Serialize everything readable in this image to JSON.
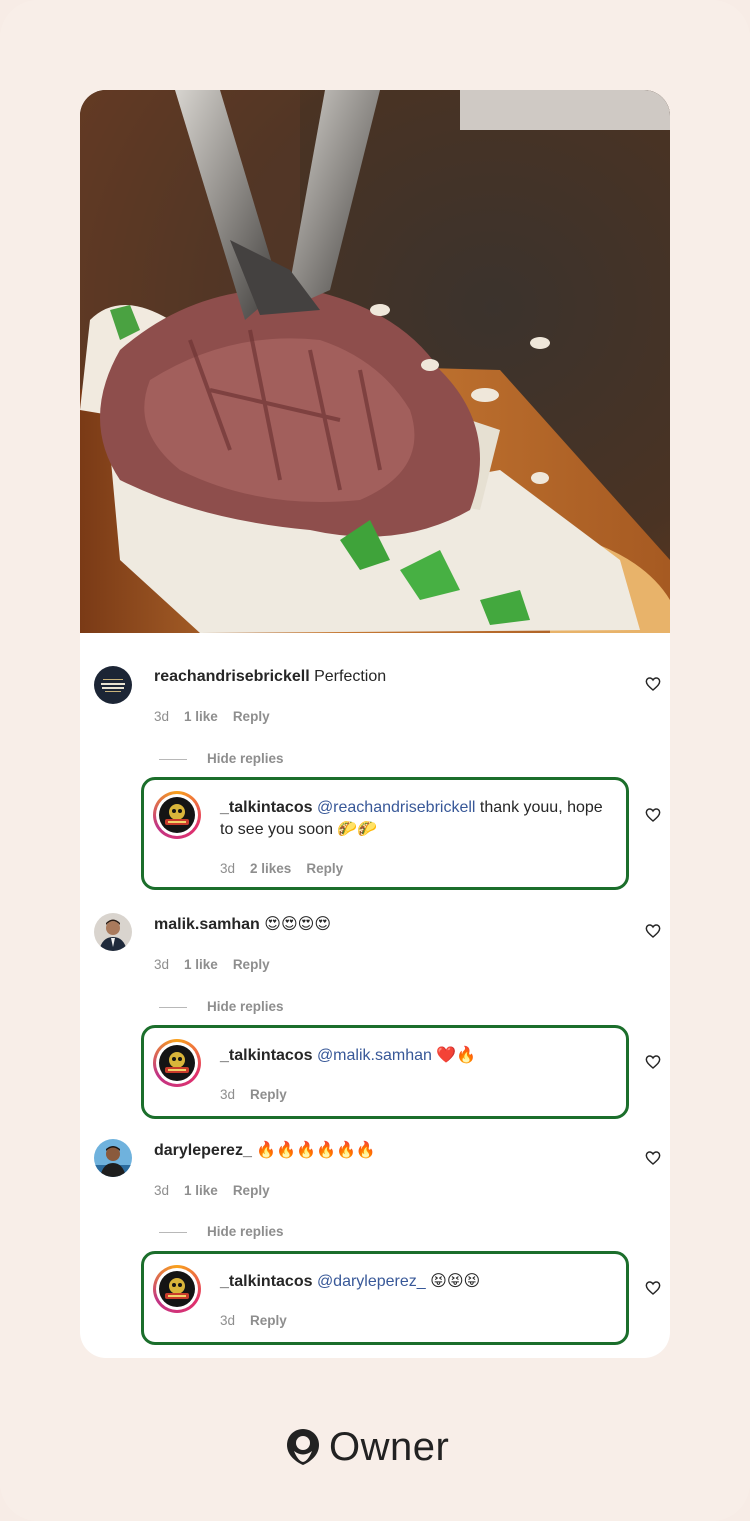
{
  "comments": [
    {
      "username": "reachandrisebrickell",
      "text": "Perfection",
      "time": "3d",
      "likes": "1 like",
      "reply": "Reply",
      "hide_replies": "Hide replies",
      "reply_item": {
        "username": "_talkintacos",
        "mention": "@reachandrisebrickell",
        "text_line1": "thank youu, hope",
        "text_line2": "to see you soon 🌮🌮",
        "time": "3d",
        "likes": "2 likes",
        "reply": "Reply"
      }
    },
    {
      "username": "malik.samhan",
      "text": "😍😍😍😍",
      "time": "3d",
      "likes": "1 like",
      "reply": "Reply",
      "hide_replies": "Hide replies",
      "reply_item": {
        "username": "_talkintacos",
        "mention": "@malik.samhan",
        "text": "❤️🔥",
        "time": "3d",
        "reply": "Reply"
      }
    },
    {
      "username": "daryleperez_",
      "text": "🔥🔥🔥🔥🔥🔥",
      "time": "3d",
      "likes": "1 like",
      "reply": "Reply",
      "hide_replies": "Hide replies",
      "reply_item": {
        "username": "_talkintacos",
        "mention": "@daryleperez_",
        "text": "😝😝😝",
        "time": "3d",
        "reply": "Reply"
      }
    }
  ],
  "footer": {
    "brand": "Owner"
  },
  "colors": {
    "highlight": "#1b6e2b",
    "mention": "#385898",
    "meta": "#8e8e8e"
  }
}
